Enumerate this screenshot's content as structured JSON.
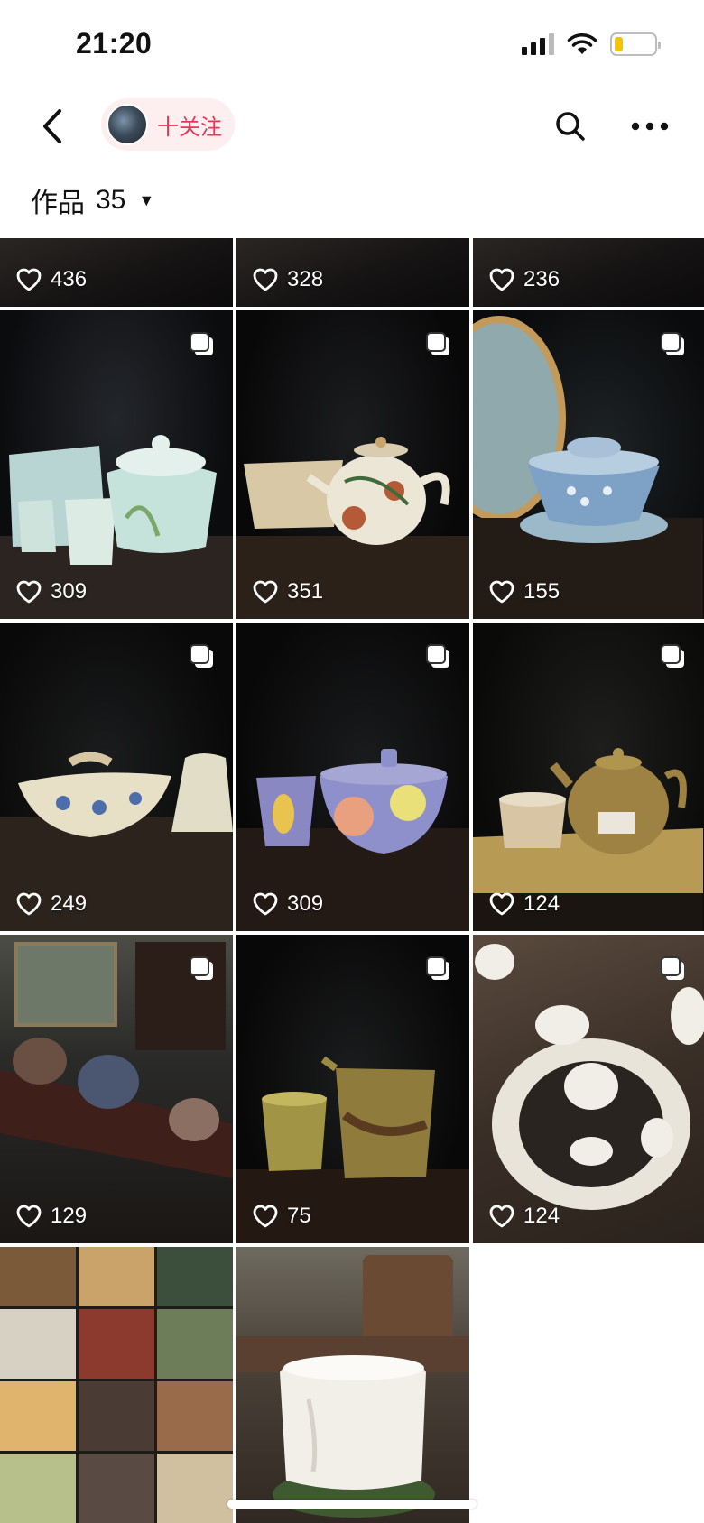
{
  "status_bar": {
    "time": "21:20"
  },
  "nav": {
    "follow_label": "十关注"
  },
  "works": {
    "title": "作品",
    "count": "35"
  },
  "posts": [
    {
      "likes": "436",
      "multi": false,
      "scene": "dark"
    },
    {
      "likes": "328",
      "multi": false,
      "scene": "dark"
    },
    {
      "likes": "236",
      "multi": false,
      "scene": "dark"
    },
    {
      "likes": "309",
      "multi": true,
      "scene": "celadon-set"
    },
    {
      "likes": "351",
      "multi": true,
      "scene": "persimmon-teapot"
    },
    {
      "likes": "155",
      "multi": true,
      "scene": "blue-gaiwan"
    },
    {
      "likes": "249",
      "multi": true,
      "scene": "floral-bowl"
    },
    {
      "likes": "309",
      "multi": true,
      "scene": "purple-flower-bowl"
    },
    {
      "likes": "124",
      "multi": true,
      "scene": "ochre-teapot"
    },
    {
      "likes": "129",
      "multi": true,
      "scene": "shelf-teaset"
    },
    {
      "likes": "75",
      "multi": true,
      "scene": "olive-pitcher"
    },
    {
      "likes": "124",
      "multi": true,
      "scene": "white-teaset-table"
    },
    {
      "likes": "",
      "multi": false,
      "scene": "collage"
    },
    {
      "likes": "",
      "multi": false,
      "scene": "white-cup"
    }
  ]
}
